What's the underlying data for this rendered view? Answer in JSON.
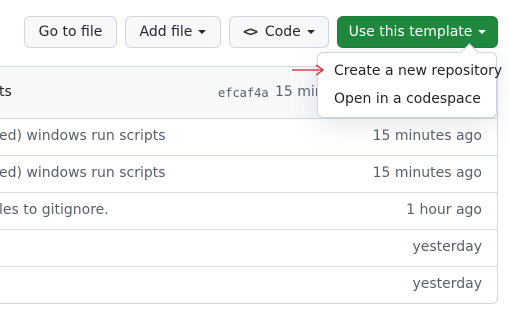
{
  "toolbar": {
    "go_to_file": "Go to file",
    "add_file": "Add file",
    "code": "Code",
    "use_template": "Use this template"
  },
  "latest_commit": {
    "message": "ts",
    "sha": "efcaf4a",
    "time": "15 min"
  },
  "files": [
    {
      "message": "ed) windows run scripts",
      "time": "15 minutes ago"
    },
    {
      "message": "ed) windows run scripts",
      "time": "15 minutes ago"
    },
    {
      "message": "les to gitignore.",
      "time": "1 hour ago"
    },
    {
      "message": "",
      "time": "yesterday"
    },
    {
      "message": "",
      "time": "yesterday"
    }
  ],
  "template_menu": {
    "items": [
      "Create a new repository",
      "Open in a codespace"
    ]
  },
  "colors": {
    "primary_green": "#1f883d",
    "annotation_arrow": "#d1242f"
  },
  "icons": {
    "code": "code-brackets-icon",
    "caret": "triangle-down-icon",
    "annotation": "arrow-right-icon"
  }
}
